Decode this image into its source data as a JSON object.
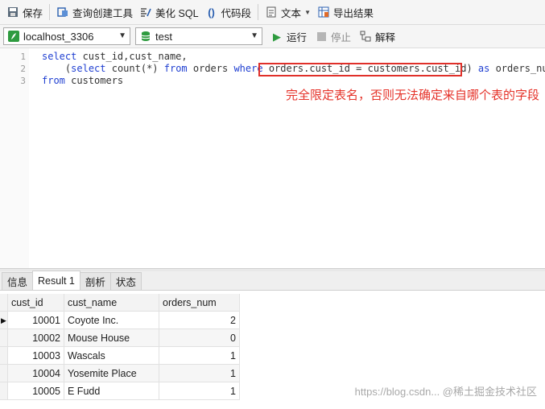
{
  "toolbar": {
    "save": "保存",
    "query_builder": "查询创建工具",
    "beautify_sql": "美化 SQL",
    "code_snippet": "代码段",
    "text": "文本",
    "export": "导出结果"
  },
  "connection": {
    "server": "localhost_3306",
    "database": "test",
    "run": "运行",
    "stop": "停止",
    "explain": "解释"
  },
  "editor": {
    "line_numbers": [
      "1",
      "2",
      "3"
    ],
    "line1": {
      "kw1": "select",
      "rest": " cust_id,cust_name,"
    },
    "line2": {
      "indent": "    ",
      "p1": "(",
      "kw1": "select",
      "t1": " count(*) ",
      "kw2": "from",
      "t2": " orders ",
      "kw3": "where",
      "t3": " ",
      "highlight": "orders.cust_id = customers.cust_id",
      "t4": ") ",
      "kw4": "as",
      "t5": " orders_num"
    },
    "line3": {
      "kw1": "from",
      "rest": " customers"
    },
    "annotation": "完全限定表名，否则无法确定来自哪个表的字段"
  },
  "tabs": [
    "信息",
    "Result 1",
    "剖析",
    "状态"
  ],
  "grid": {
    "columns": [
      "cust_id",
      "cust_name",
      "orders_num"
    ],
    "rows": [
      {
        "cust_id": "10001",
        "cust_name": "Coyote Inc.",
        "orders_num": "2"
      },
      {
        "cust_id": "10002",
        "cust_name": "Mouse House",
        "orders_num": "0"
      },
      {
        "cust_id": "10003",
        "cust_name": "Wascals",
        "orders_num": "1"
      },
      {
        "cust_id": "10004",
        "cust_name": "Yosemite Place",
        "orders_num": "1"
      },
      {
        "cust_id": "10005",
        "cust_name": "E Fudd",
        "orders_num": "1"
      }
    ]
  },
  "watermark": "https://blog.csdn... @稀土掘金技术社区",
  "colors": {
    "keyword": "#1f3fd1",
    "annotation": "#e5332a"
  }
}
